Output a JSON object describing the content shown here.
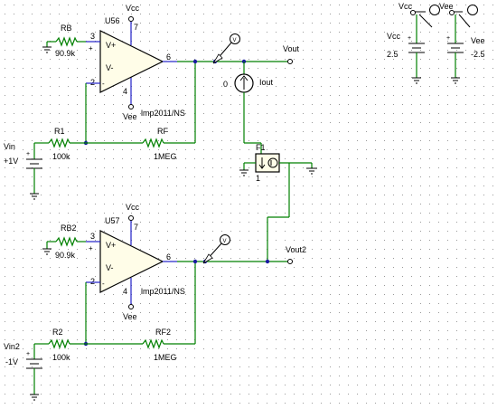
{
  "opamp1": {
    "ref": "U56",
    "model": "lmp2011/NS",
    "vcc": "Vcc",
    "vee": "Vee",
    "pin_inp": "3",
    "pin_inn": "2",
    "pin_out": "6",
    "pin_vp": "7",
    "pin_vn": "4",
    "vplus": "V+",
    "vminus": "V-"
  },
  "opamp2": {
    "ref": "U57",
    "model": "lmp2011/NS",
    "vcc": "Vcc",
    "vee": "Vee",
    "pin_inp": "3",
    "pin_inn": "2",
    "pin_out": "6",
    "pin_vp": "7",
    "pin_vn": "4",
    "vplus": "V+",
    "vminus": "V-"
  },
  "rb": {
    "ref": "RB",
    "value": "90.9k"
  },
  "rb2": {
    "ref": "RB2",
    "value": "90.9k"
  },
  "r1": {
    "ref": "R1",
    "value": "100k"
  },
  "r2": {
    "ref": "R2",
    "value": "100k"
  },
  "rf": {
    "ref": "RF",
    "value": "1MEG"
  },
  "rf2": {
    "ref": "RF2",
    "value": "1MEG"
  },
  "vin": {
    "ref": "Vin",
    "value": "+1V",
    "plus": "+"
  },
  "vin2": {
    "ref": "Vin2",
    "value": "-1V",
    "plus": "+"
  },
  "vout": "Vout",
  "vout2": "Vout2",
  "iout": {
    "ref": "Iout",
    "value": "0"
  },
  "f1": {
    "ref": "F1",
    "gain": "1"
  },
  "supplies": {
    "vcc_net": "Vcc",
    "vee_net": "Vee",
    "vcc_src": {
      "ref": "Vcc",
      "value": "2.5",
      "plus": "+"
    },
    "vee_src": {
      "ref": "Vee",
      "value": "-2.5",
      "plus": "+"
    }
  },
  "probes": {
    "p1": "V",
    "p2": "V"
  }
}
